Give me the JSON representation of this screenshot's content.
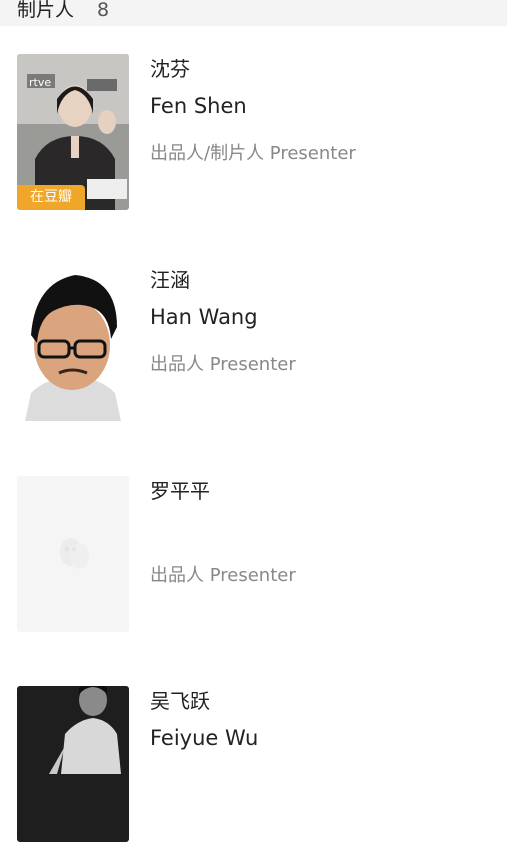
{
  "header": {
    "title": "制片人",
    "count": "8"
  },
  "people": [
    {
      "name_zh": "沈芬",
      "name_en": "Fen Shen",
      "role": "出品人/制片人 Presenter",
      "badge": "在豆瓣"
    },
    {
      "name_zh": "汪涵",
      "name_en": "Han Wang",
      "role": "出品人 Presenter"
    },
    {
      "name_zh": "罗平平",
      "role": "出品人 Presenter"
    },
    {
      "name_zh": "吴飞跃",
      "name_en": "Feiyue Wu"
    }
  ],
  "colors": {
    "badge_bg": "#f0a628",
    "header_bg": "#f4f4f4",
    "role_text": "#888888"
  }
}
